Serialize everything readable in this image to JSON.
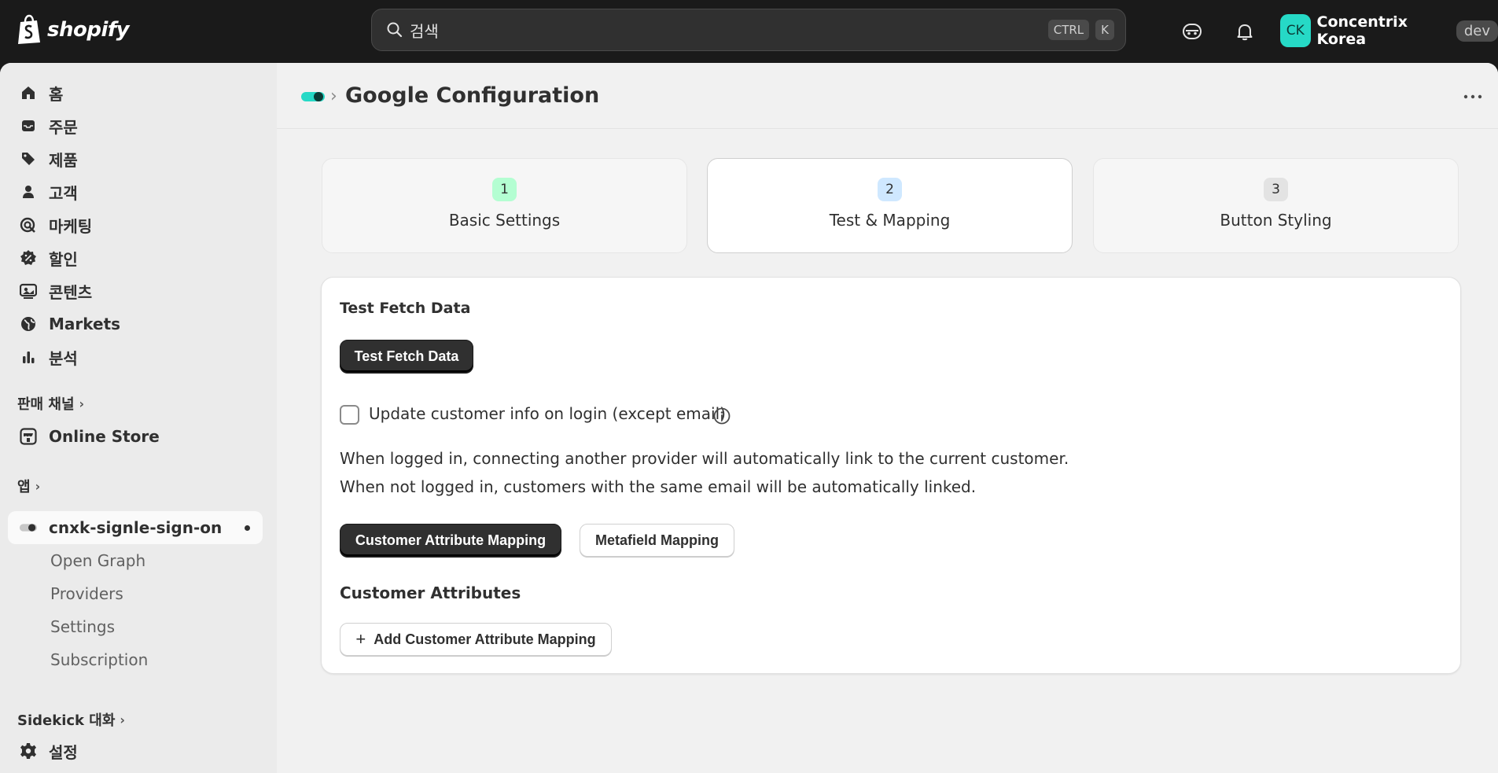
{
  "topbar": {
    "brand": "shopify",
    "search_placeholder": "검색",
    "shortcut_keys": [
      "CTRL",
      "K"
    ],
    "account": {
      "initials": "CK",
      "name": "Concentrix Korea",
      "badge": "dev"
    }
  },
  "sidebar": {
    "items": [
      {
        "label": "홈",
        "icon": "home-icon"
      },
      {
        "label": "주문",
        "icon": "inbox-icon"
      },
      {
        "label": "제품",
        "icon": "tag-icon"
      },
      {
        "label": "고객",
        "icon": "person-icon"
      },
      {
        "label": "마케팅",
        "icon": "target-icon"
      },
      {
        "label": "할인",
        "icon": "discount-icon"
      },
      {
        "label": "콘텐츠",
        "icon": "image-icon"
      },
      {
        "label": "Markets",
        "icon": "globe-icon"
      },
      {
        "label": "분석",
        "icon": "chart-icon"
      }
    ],
    "sales_channels_label": "판매 채널",
    "online_store_label": "Online Store",
    "apps_label": "앱",
    "app_name": "cnxk-signle-sign-on",
    "app_subitems": [
      "Open Graph",
      "Providers",
      "Settings",
      "Subscription"
    ],
    "sidekick_label": "Sidekick 대화",
    "settings_label": "설정"
  },
  "page": {
    "title": "Google Configuration",
    "steps": [
      {
        "num": "1",
        "label": "Basic Settings",
        "num_bg": "#b4fed2"
      },
      {
        "num": "2",
        "label": "Test & Mapping",
        "num_bg": "#cfe8ff"
      },
      {
        "num": "3",
        "label": "Button Styling",
        "num_bg": "#e3e3e3"
      }
    ],
    "active_step": 2,
    "card": {
      "title": "Test Fetch Data",
      "fetch_button": "Test Fetch Data",
      "checkbox_label": "Update customer info on login (except email)",
      "checkbox_checked": false,
      "desc_line1": "When logged in, connecting another provider will automatically link to the current customer.",
      "desc_line2": "When not logged in, customers with the same email will be automatically linked.",
      "tab_attribute": "Customer Attribute Mapping",
      "tab_metafield": "Metafield Mapping",
      "section_title": "Customer Attributes",
      "add_button": "Add Customer Attribute Mapping"
    }
  },
  "colors": {
    "topbar": "#1a1a1a",
    "accent_teal": "#26d9c6",
    "primary_button": "#303030"
  }
}
